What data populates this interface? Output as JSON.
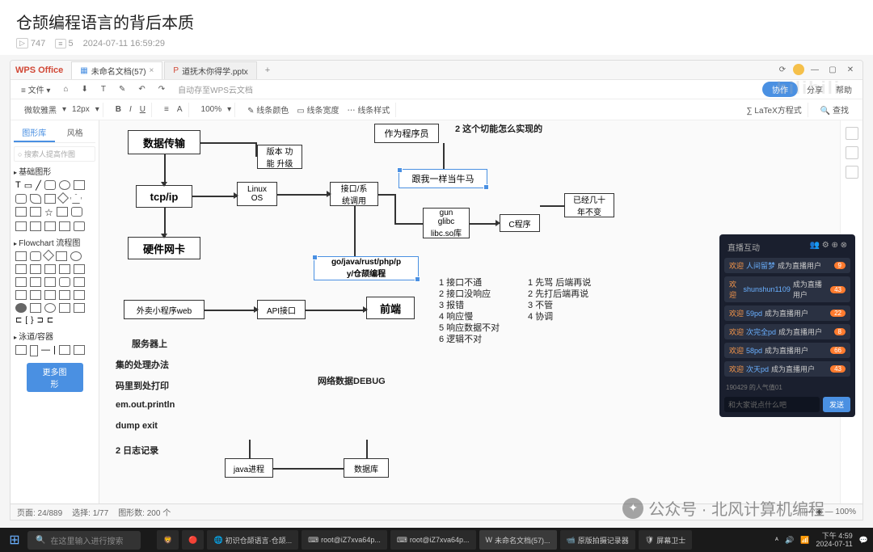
{
  "page": {
    "title": "仓颉编程语言的背后本质",
    "plays": "747",
    "danmu": "5",
    "time": "2024-07-11 16:59:29"
  },
  "window": {
    "app": "WPS Office",
    "tab1": "未命名文档(57)",
    "tab2": "道抚木你得学.pptx",
    "new": "+"
  },
  "menu": {
    "file": "文件",
    "b1": "协作",
    "b2": "分享",
    "b3": "帮助",
    "tip": "自动存至WPS云文档"
  },
  "toolbar": {
    "font": "微软雅黑",
    "size": "12px",
    "bold": "B",
    "italic": "I",
    "under": "U",
    "pct": "100%",
    "t1": "线条颜色",
    "t2": "线条宽度",
    "t3": "线条样式",
    "latex": "LaTeX方程式",
    "find": "查找"
  },
  "panel": {
    "tab1": "图形库",
    "tab2": "风格",
    "search": "搜索人提高作图",
    "s1": "基础图形",
    "s2": "Flowchart 流程图",
    "s3": "泳道/容器",
    "more": "更多图形"
  },
  "nodes": {
    "n1": "数据传输",
    "n2": "版本 功\n能 升级",
    "n3": "作为程序员",
    "n4": "tcp/ip",
    "n5": "Linux\nOS",
    "n6": "接口/系\n统调用",
    "n7": "跟我一样当牛马",
    "n8": "已经几十\n年不变",
    "n9": "硬件网卡",
    "n10": "gun\nglibc\nlibc.so库",
    "n11": "C程序",
    "n12": "go/java/rust/php/p\ny/仓颉编程",
    "n13": "外卖小程序web",
    "n14": "API接口",
    "n15": "前端",
    "n16": "java进程",
    "n17": "数据库",
    "top": "2 这个切能怎么实现的"
  },
  "list": {
    "l1": "1 接口不通",
    "l2": "2 接口没响应",
    "l3": "3 报错",
    "l4": "4 响应慢",
    "l5": "5 响应数据不对",
    "l6": "6 逻辑不对",
    "r1": "1 先骂 后端再说",
    "r2": "2 先打后端再说",
    "r3": "3 不管",
    "r4": "4 协调"
  },
  "sidetxt": {
    "t1": "服务器上",
    "t2": "集的处理办法",
    "t3": "码里到处打印",
    "t4": "em.out.println",
    "t5": "dump exit",
    "t6": "2 日志记录",
    "debug": "网络数据DEBUG"
  },
  "live": {
    "title": "直播互动",
    "rows": [
      {
        "pre": "欢迎",
        "user": "人间留梦",
        "suf": "成为直播用户",
        "b": "9"
      },
      {
        "pre": "欢迎",
        "user": "shunshun1109",
        "suf": "成为直播用户",
        "b": "43"
      },
      {
        "pre": "欢迎",
        "user": "59pd",
        "suf": "成为直播用户",
        "b": "22"
      },
      {
        "pre": "欢迎",
        "user": "次完全pd",
        "suf": "成为直播用户",
        "b": "8"
      },
      {
        "pre": "欢迎",
        "user": "58pd",
        "suf": "成为直播用户",
        "b": "66"
      },
      {
        "pre": "欢迎",
        "user": "次天pd",
        "suf": "成为直播用户",
        "b": "43"
      }
    ],
    "meta": "190429 的人气值01",
    "placeholder": "和大家说点什么吧",
    "send": "发送"
  },
  "status": {
    "pages": "页面: 24/889",
    "sel": "选择: 1/77",
    "shapes": "图形数: 200 个"
  },
  "taskbar": {
    "search": "在这里输入进行搜索",
    "a1": "初识仓颉语言·仓颉...",
    "a2": "root@iZ7xva64p...",
    "a3": "root@iZ7xva64p...",
    "a4": "未命名文档(57)...",
    "a5": "原版拍摄记录器",
    "a6": "屏幕卫士",
    "time": "下午 4:59",
    "date": "2024-07-11"
  },
  "watermark": "公众号 · 北风计算机编程",
  "faint": "bilibili"
}
